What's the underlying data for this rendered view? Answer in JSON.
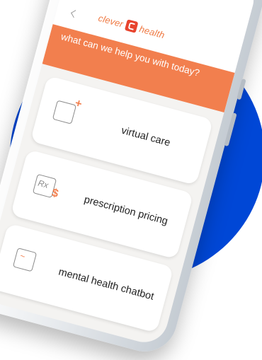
{
  "header": {
    "logo_left": "clever",
    "logo_right": "health"
  },
  "banner": {
    "text": "what can we help you with today?"
  },
  "options": [
    {
      "label": "virtual care",
      "icon": "virtual-care-icon"
    },
    {
      "label": "prescription pricing",
      "icon": "prescription-icon"
    },
    {
      "label": "mental health chatbot",
      "icon": "chatbot-icon"
    }
  ],
  "colors": {
    "brand_orange": "#f27f4e",
    "logo_red": "#e8442e",
    "background_blue": "#0047d6"
  }
}
